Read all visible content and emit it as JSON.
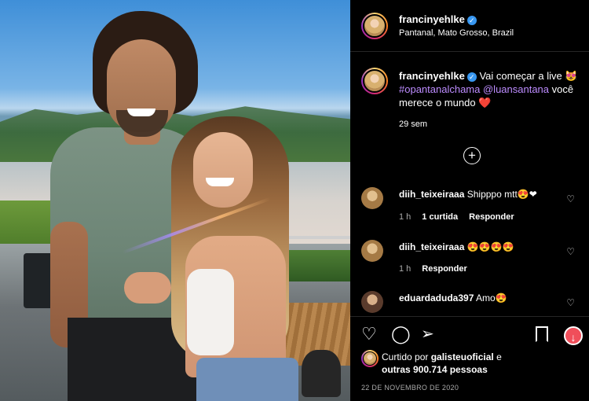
{
  "post": {
    "author": "francinyehlke",
    "location": "Pantanal, Mato Grosso, Brazil",
    "caption_text": "Vai começar a live 😻",
    "caption_tag1": "#opantanalchama",
    "caption_tag2": "@luansantana",
    "caption_end": "você merece o mundo ❤️",
    "age": "29 sem",
    "load_more_symbol": "+"
  },
  "comments": [
    {
      "user": "diih_teixeiraaa",
      "text": "Shipppo mtt😍❤",
      "time": "1 h",
      "likes": "1 curtida",
      "reply": "Responder"
    },
    {
      "user": "diih_teixeiraaa",
      "text": "😍😍😍😍",
      "time": "1 h",
      "reply": "Responder"
    },
    {
      "user": "eduardaduda397",
      "text": "Amo😍"
    }
  ],
  "likes": {
    "prefix": "Curtido por",
    "user": "galisteuoficial",
    "and": "e",
    "others": "outras 900.714 pessoas"
  },
  "date": "22 DE NOVEMBRO DE 2020",
  "icons": {
    "like": "heart-icon",
    "comment": "comment-icon",
    "share": "paper-plane-icon",
    "save": "bookmark-icon",
    "download": "download-icon"
  },
  "colors": {
    "background": "#000000",
    "tag": "#bd8cff",
    "verified": "#3897f0",
    "download": "#f04e5a"
  }
}
